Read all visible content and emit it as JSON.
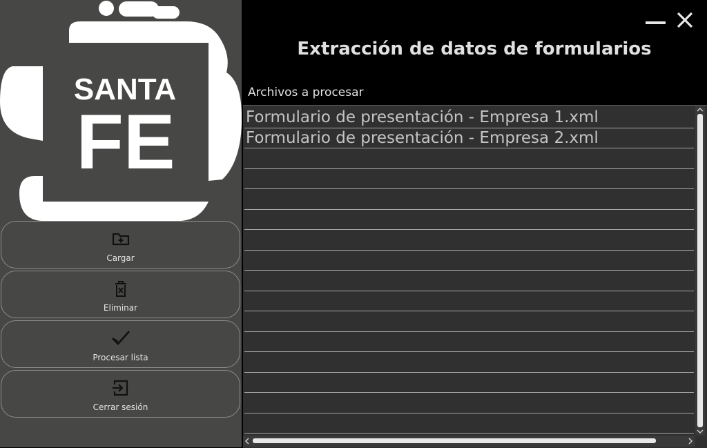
{
  "app": {
    "title": "Extracción de datos de formularios",
    "logo_text": [
      "SANTA",
      "FE"
    ]
  },
  "window_controls": {
    "minimize_icon": "minimize-icon",
    "close_icon": "close-icon"
  },
  "sidebar": {
    "buttons": [
      {
        "label": "Cargar",
        "icon": "folder-plus-icon"
      },
      {
        "label": "Eliminar",
        "icon": "trash-icon"
      },
      {
        "label": "Procesar lista",
        "icon": "checkmark-icon"
      },
      {
        "label": "Cerrar sesión",
        "icon": "logout-icon"
      }
    ]
  },
  "files": {
    "label": "Archivos a procesar",
    "items": [
      "Formulario de presentación - Empresa 1.xml",
      "Formulario de presentación - Empresa 2.xml"
    ]
  },
  "colors": {
    "sidebar_bg": "#474745",
    "main_bg": "#000000",
    "list_bg": "#303030",
    "text": "#e0e0e0"
  }
}
